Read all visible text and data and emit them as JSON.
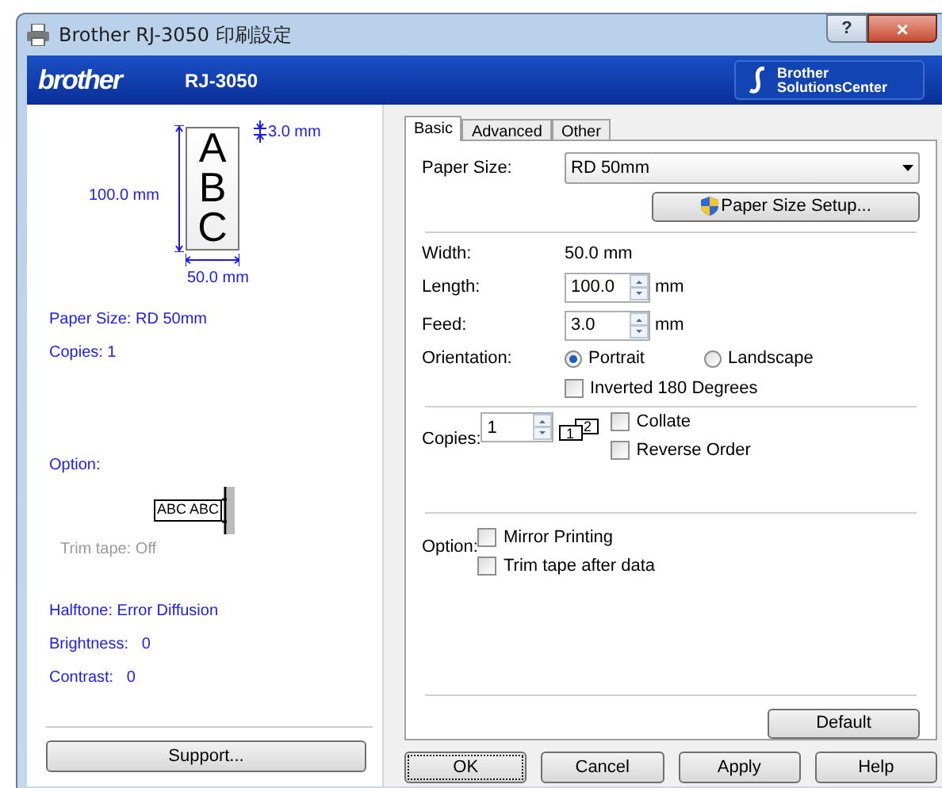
{
  "window": {
    "title": "Brother RJ-3050 印刷設定",
    "help_button": "?",
    "close_button": "×"
  },
  "banner": {
    "logo": "brother",
    "model": "RJ-3050",
    "solutions": [
      "Brother",
      "SolutionsCenter"
    ]
  },
  "preview": {
    "letters": [
      "A",
      "B",
      "C"
    ],
    "feed_label": "3.0 mm",
    "height_label": "100.0 mm",
    "width_label": "50.0 mm"
  },
  "summary": [
    {
      "text": "Paper Size: RD 50mm",
      "kind": "info"
    },
    {
      "text": "Copies: 1",
      "kind": "info"
    }
  ],
  "option_summary": {
    "label": "Option:",
    "tape_text": "ABC ABC",
    "trim": "Trim tape: Off"
  },
  "print_summary": [
    "Halftone: Error Diffusion",
    "Brightness:   0",
    "Contrast:   0"
  ],
  "support_button": "Support...",
  "tabs": [
    {
      "label": "Basic",
      "selected": true
    },
    {
      "label": "Advanced",
      "selected": false
    },
    {
      "label": "Other",
      "selected": false
    }
  ],
  "paper_size": {
    "label": "Paper Size:",
    "value": "RD 50mm",
    "setup_button": "Paper Size Setup..."
  },
  "width": {
    "label": "Width:",
    "value": "50.0 mm"
  },
  "length": {
    "label": "Length:",
    "value": "100.0",
    "unit": "mm"
  },
  "feed": {
    "label": "Feed:",
    "value": "3.0",
    "unit": "mm"
  },
  "orientation": {
    "label": "Orientation:",
    "options": [
      {
        "label": "Portrait",
        "selected": true
      },
      {
        "label": "Landscape",
        "selected": false
      }
    ],
    "inverted": {
      "label": "Inverted 180 Degrees",
      "checked": false
    }
  },
  "copies": {
    "label": "Copies:",
    "value": "1",
    "collate_icon": [
      "1",
      "2"
    ],
    "options": [
      {
        "label": "Collate",
        "checked": false
      },
      {
        "label": "Reverse Order",
        "checked": false
      }
    ]
  },
  "option": {
    "label": "Option:",
    "options": [
      {
        "label": "Mirror Printing",
        "checked": false
      },
      {
        "label": "Trim tape after data",
        "checked": false
      }
    ]
  },
  "default_button": "Default",
  "buttons": [
    "OK",
    "Cancel",
    "Apply",
    "Help"
  ]
}
